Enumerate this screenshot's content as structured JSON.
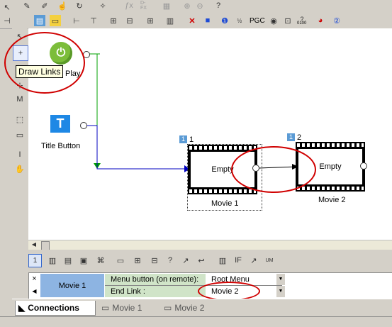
{
  "tooltip": {
    "label": "Draw Links"
  },
  "toolbar": {
    "pgc_label": "PGC",
    "timecode_label": "0100",
    "dfx_label": "D-FX"
  },
  "canvas": {
    "play_button": {
      "label": "Play"
    },
    "title_button": {
      "label": "Title Button",
      "glyph": "T"
    },
    "movie1": {
      "badge": "1",
      "number": "1",
      "content": "Empty",
      "label": "Movie 1"
    },
    "movie2": {
      "badge": "1",
      "number": "2",
      "content": "Empty",
      "label": "Movie 2"
    }
  },
  "button_toolbar": {
    "selected": "1"
  },
  "properties": {
    "title": "Movie 1",
    "close_glyph": "×",
    "row1_label": "Menu button (on remote):",
    "row1_value": "Root Menu",
    "row2_label": "End Link :",
    "row2_value": "Movie 2"
  },
  "tabs": [
    {
      "label": "Connections"
    },
    {
      "label": "Movie 1"
    },
    {
      "label": "Movie 2"
    }
  ],
  "colors": {
    "link_green": "#00a000",
    "link_blue": "#0000c0",
    "highlight_red": "#d00000",
    "accent_blue": "#5b9bd5",
    "play_green": "#7cbd3a",
    "title_blue": "#1e88e5",
    "prop_title_bg": "#8db4e2"
  }
}
